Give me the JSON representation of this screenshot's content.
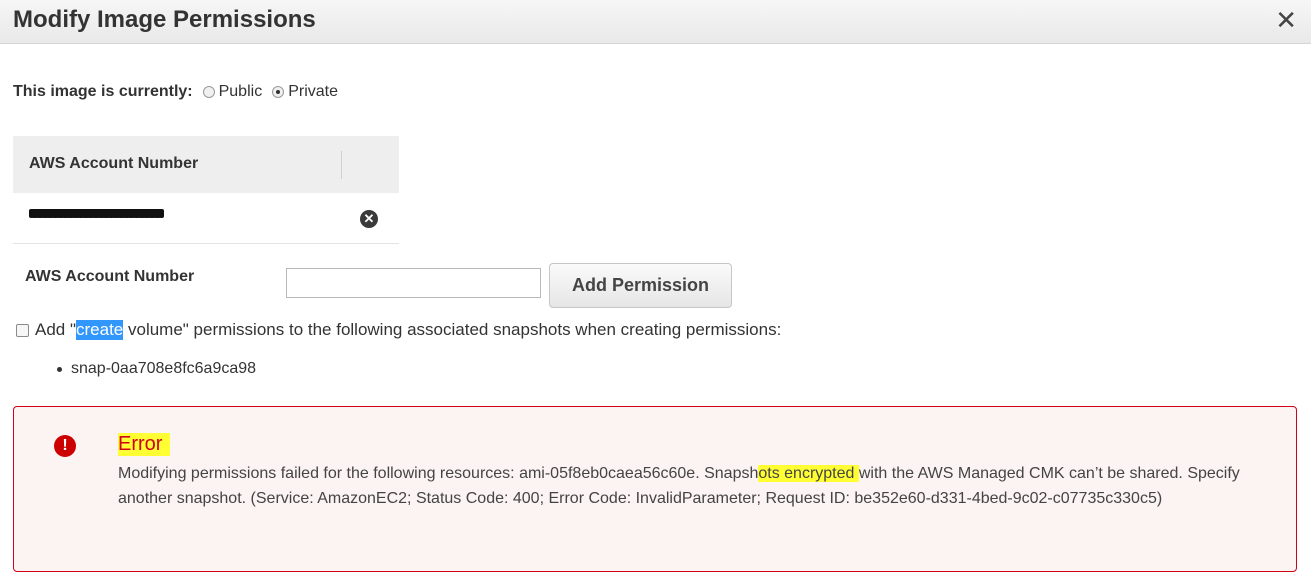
{
  "dialog": {
    "title": "Modify Image Permissions",
    "close_glyph": "✕"
  },
  "visibility": {
    "label": "This image is currently:",
    "options": [
      "Public",
      "Private"
    ],
    "selected": "Private"
  },
  "accounts_table": {
    "header": "AWS Account Number",
    "rows": [
      {
        "account": "[redacted]"
      }
    ]
  },
  "add_form": {
    "label": "AWS Account Number",
    "input_value": "",
    "button": "Add Permission"
  },
  "create_volume": {
    "prefix": "Add \"",
    "selected_word": "create",
    "suffix": " volume\" permissions to the following associated snapshots when creating permissions:",
    "checked": false,
    "snapshots": [
      "snap-0aa708e8fc6a9ca98"
    ]
  },
  "error": {
    "title": "Error",
    "msg_part1": "Modifying permissions failed for the following resources: ami-05f8eb0caea56c60e. Snapsh",
    "msg_highlight": "ots encrypted ",
    "msg_part2": "with the AWS Managed CMK can’t be shared. Specify another snapshot. (Service: AmazonEC2; Status Code: 400; Error Code: InvalidParameter; Request ID: be352e60-d331-4bed-9c02-c07735c330c5)",
    "colors": {
      "border": "#d0021b",
      "highlight": "#ffff33"
    }
  },
  "icons": {
    "close": "close-icon",
    "remove": "remove-circle-icon",
    "error": "exclamation-circle-icon"
  }
}
